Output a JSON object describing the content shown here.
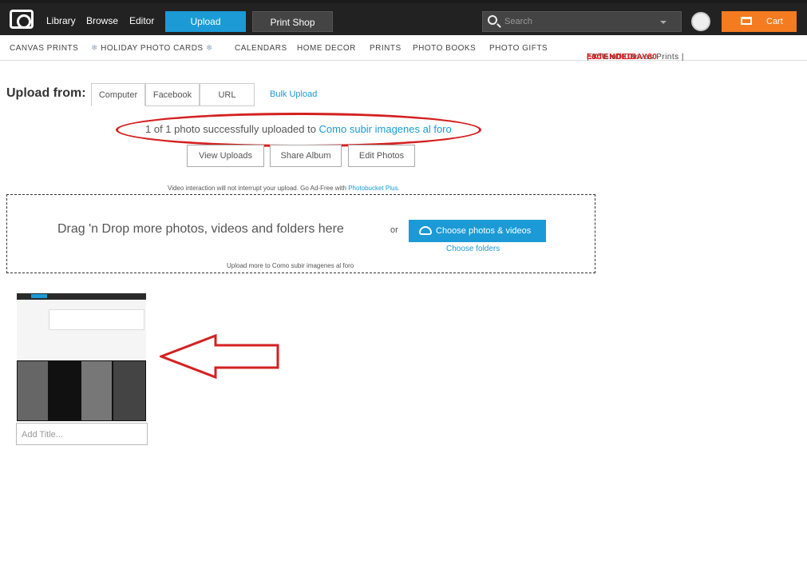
{
  "topbar": {
    "nav": [
      "Library",
      "Browse",
      "Editor"
    ],
    "upload_label": "Upload",
    "print_shop_label": "Print Shop",
    "search_placeholder": "Search",
    "cart_label": "Cart"
  },
  "subnav": {
    "items": [
      "CANVAS PRINTS",
      "HOLIDAY PHOTO CARDS",
      "CALENDARS",
      "HOME DECOR",
      "PRINTS",
      "PHOTO BOOKS",
      "PHOTO GIFTS"
    ],
    "promo_prefix": "EXTENDED!",
    "promo_middle": " | 80% off Canvas Prints | ",
    "promo_code": "code HOLIDAY80"
  },
  "upload": {
    "label": "Upload from:",
    "tabs": [
      "Computer",
      "Facebook",
      "URL"
    ],
    "bulk_label": "Bulk Upload",
    "success_text": "1 of 1 photo successfully uploaded to ",
    "album_link": "Como subir imagenes al foro",
    "actions": [
      "View Uploads",
      "Share Album",
      "Edit Photos"
    ]
  },
  "dropzone": {
    "notice_text": "Video interaction will not interrupt your upload. Go Ad-Free with ",
    "notice_link": "Photobucket Plus.",
    "drag_text": "Drag 'n Drop more photos, videos and folders here",
    "or_text": "or",
    "choose_label": "Choose photos & videos",
    "choose_folders": "Choose folders",
    "upload_more": "Upload more to Como subir imagenes al foro"
  },
  "thumbnail": {
    "title_placeholder": "Add Title..."
  },
  "colors": {
    "accent": "#1b9ad6",
    "cart": "#f47b20",
    "annotation": "#d42020"
  }
}
